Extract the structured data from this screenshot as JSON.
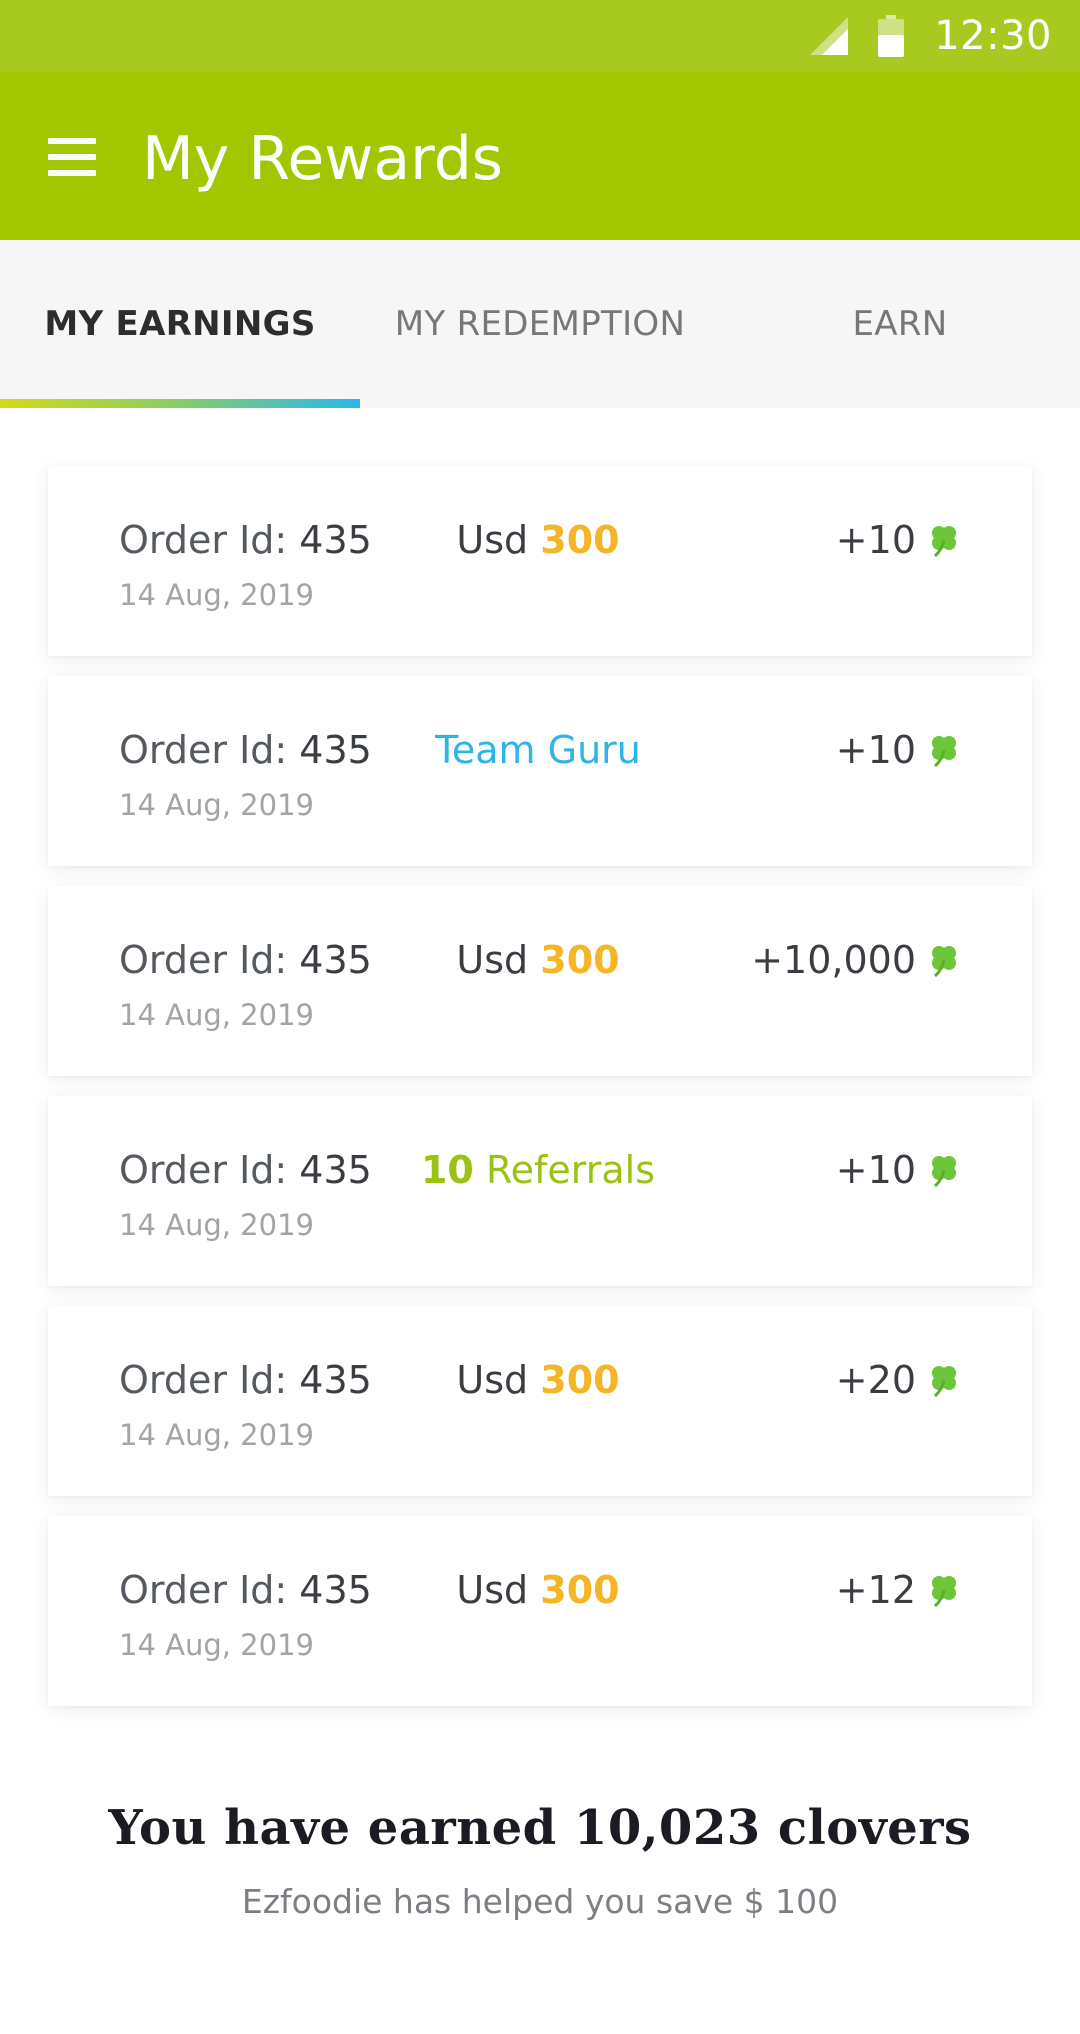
{
  "status_bar": {
    "time": "12:30"
  },
  "app_bar": {
    "title": "My Rewards"
  },
  "tabs": [
    {
      "label": "MY EARNINGS",
      "active": true
    },
    {
      "label": "MY REDEMPTION",
      "active": false
    },
    {
      "label": "EARN",
      "active": false
    }
  ],
  "earnings": [
    {
      "order_label": "Order Id:",
      "order_id": "435",
      "date": "14 Aug, 2019",
      "currency": "Usd",
      "amount": "300",
      "points": "+10"
    },
    {
      "order_label": "Order Id:",
      "order_id": "435",
      "date": "14 Aug, 2019",
      "badge": "Team Guru",
      "points": "+10"
    },
    {
      "order_label": "Order Id:",
      "order_id": "435",
      "date": "14 Aug, 2019",
      "currency": "Usd",
      "amount": "300",
      "points": "+10,000"
    },
    {
      "order_label": "Order Id:",
      "order_id": "435",
      "date": "14 Aug, 2019",
      "referral_count": "10",
      "referral_label": "Referrals",
      "points": "+10"
    },
    {
      "order_label": "Order Id:",
      "order_id": "435",
      "date": "14 Aug, 2019",
      "currency": "Usd",
      "amount": "300",
      "points": "+20"
    },
    {
      "order_label": "Order Id:",
      "order_id": "435",
      "date": "14 Aug, 2019",
      "currency": "Usd",
      "amount": "300",
      "points": "+12"
    }
  ],
  "summary": {
    "title": "You have earned 10,023 clovers",
    "subtitle": "Ezfoodie has helped you save $ 100"
  },
  "colors": {
    "status_bar": "#a8c920",
    "app_bar": "#a2c701",
    "amount": "#f4b526",
    "team": "#2eb4e6",
    "referral": "#9bc213",
    "clover": "#6cc63a"
  },
  "icons": {
    "menu": "menu-icon",
    "signal": "signal-icon",
    "battery": "battery-icon",
    "clover": "clover-icon"
  }
}
